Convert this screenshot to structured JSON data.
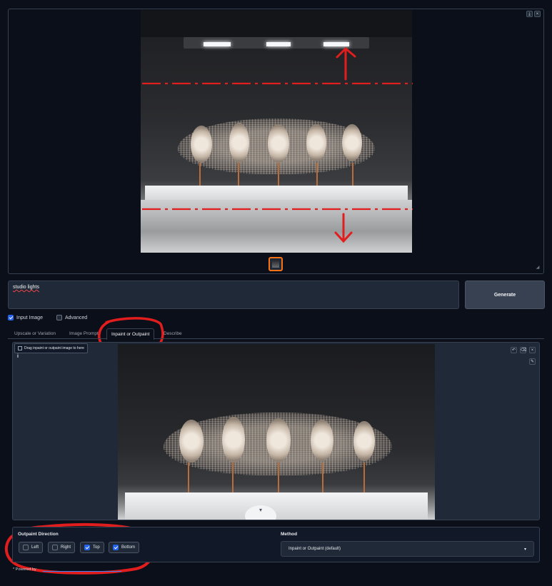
{
  "gallery": {
    "download_icon": "download-icon",
    "close_icon": "close-icon",
    "download_glyph": "⤓",
    "close_glyph": "×"
  },
  "prompt": {
    "value": "studio lights"
  },
  "generate": {
    "label": "Generate"
  },
  "options": {
    "input_image": {
      "label": "Input Image",
      "checked": true
    },
    "advanced": {
      "label": "Advanced",
      "checked": false
    }
  },
  "tabs": [
    {
      "label": "Upscale or Variation"
    },
    {
      "label": "Image Prompt"
    },
    {
      "label": "Inpaint or Outpaint",
      "active": true
    },
    {
      "label": "Describe"
    }
  ],
  "inpaint": {
    "drop_label": "Drag inpaint or outpaint image to here",
    "info_glyph": "i",
    "undo_glyph": "↶",
    "clear_glyph": "⌫",
    "close_glyph": "×",
    "brush_glyph": "✎",
    "handle_glyph": "▾"
  },
  "outpaint": {
    "title": "Outpaint Direction",
    "directions": [
      {
        "label": "Left",
        "checked": false
      },
      {
        "label": "Right",
        "checked": false
      },
      {
        "label": "Top",
        "checked": true
      },
      {
        "label": "Bottom",
        "checked": true
      }
    ]
  },
  "method": {
    "title": "Method",
    "selected": "Inpaint or Outpaint (default)",
    "caret": "▾"
  },
  "footer": {
    "text": "* Powered by"
  },
  "colors": {
    "annotation_red": "#e11d1d",
    "accent_orange": "#f97316",
    "check_blue": "#2563eb"
  }
}
